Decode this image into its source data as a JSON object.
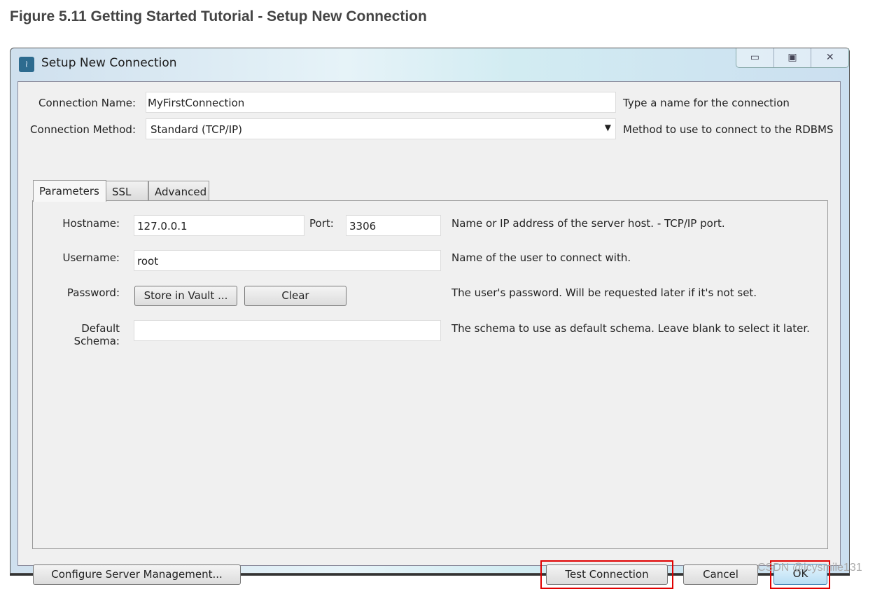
{
  "figure_caption": "Figure 5.11 Getting Started Tutorial - Setup New Connection",
  "window": {
    "title": "Setup New Connection",
    "controls": {
      "minimize": "minimize-icon",
      "maximize": "maximize-icon",
      "close": "close-icon"
    }
  },
  "connection_name": {
    "label": "Connection Name:",
    "value": "MyFirstConnection",
    "hint": "Type a name for the connection"
  },
  "connection_method": {
    "label": "Connection Method:",
    "value": "Standard (TCP/IP)",
    "hint": "Method to use to connect to the RDBMS"
  },
  "tabs": [
    {
      "label": "Parameters",
      "active": true
    },
    {
      "label": "SSL"
    },
    {
      "label": "Advanced"
    }
  ],
  "params": {
    "hostname": {
      "label": "Hostname:",
      "value": "127.0.0.1"
    },
    "port": {
      "label": "Port:",
      "value": "3306"
    },
    "hostname_hint": "Name or IP address of the server host. - TCP/IP port.",
    "username": {
      "label": "Username:",
      "value": "root",
      "hint": "Name of the user to connect with."
    },
    "password": {
      "label": "Password:",
      "store_button": "Store in Vault ...",
      "clear_button": "Clear",
      "hint": "The user's password. Will be requested later if it's not set."
    },
    "schema": {
      "label": "Default Schema:",
      "value": "",
      "hint": "The schema to use as default schema. Leave blank to select it later."
    }
  },
  "buttons": {
    "configure": "Configure Server Management...",
    "test": "Test Connection",
    "cancel": "Cancel",
    "ok": "OK"
  },
  "highlight_color": "#e00000",
  "watermark": "CSDN @icysmile131"
}
